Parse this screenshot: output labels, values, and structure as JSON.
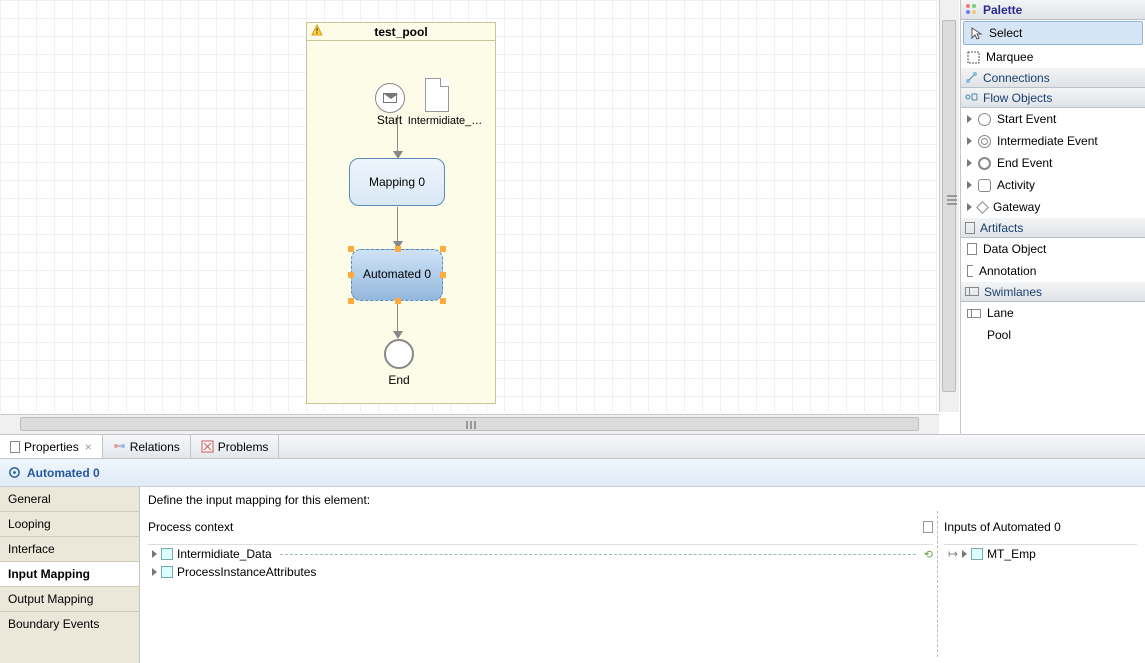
{
  "canvas": {
    "pool_title": "test_pool",
    "start_label": "Start",
    "data_label": "Intermidiate_…",
    "task_mapping_label": "Mapping 0",
    "task_automated_label": "Automated 0",
    "end_label": "End"
  },
  "palette": {
    "title": "Palette",
    "select": "Select",
    "marquee": "Marquee",
    "drawer_connections": "Connections",
    "drawer_flow_objects": "Flow Objects",
    "start_event": "Start Event",
    "intermediate_event": "Intermediate Event",
    "end_event": "End Event",
    "activity": "Activity",
    "gateway": "Gateway",
    "drawer_artifacts": "Artifacts",
    "data_object": "Data Object",
    "annotation": "Annotation",
    "drawer_swimlanes": "Swimlanes",
    "lane": "Lane",
    "pool": "Pool"
  },
  "views": {
    "properties": "Properties",
    "relations": "Relations",
    "problems": "Problems"
  },
  "properties": {
    "title": "Automated 0",
    "instruction": "Define the input mapping for this element:",
    "tabs": {
      "general": "General",
      "looping": "Looping",
      "interface": "Interface",
      "input_mapping": "Input Mapping",
      "output_mapping": "Output Mapping",
      "boundary_events": "Boundary Events"
    },
    "left_col_title": "Process context",
    "right_col_title": "Inputs of Automated 0",
    "context_items": {
      "intermidiate_data": "Intermidiate_Data",
      "process_instance_attributes": "ProcessInstanceAttributes"
    },
    "inputs": {
      "mt_emp": "MT_Emp"
    }
  }
}
